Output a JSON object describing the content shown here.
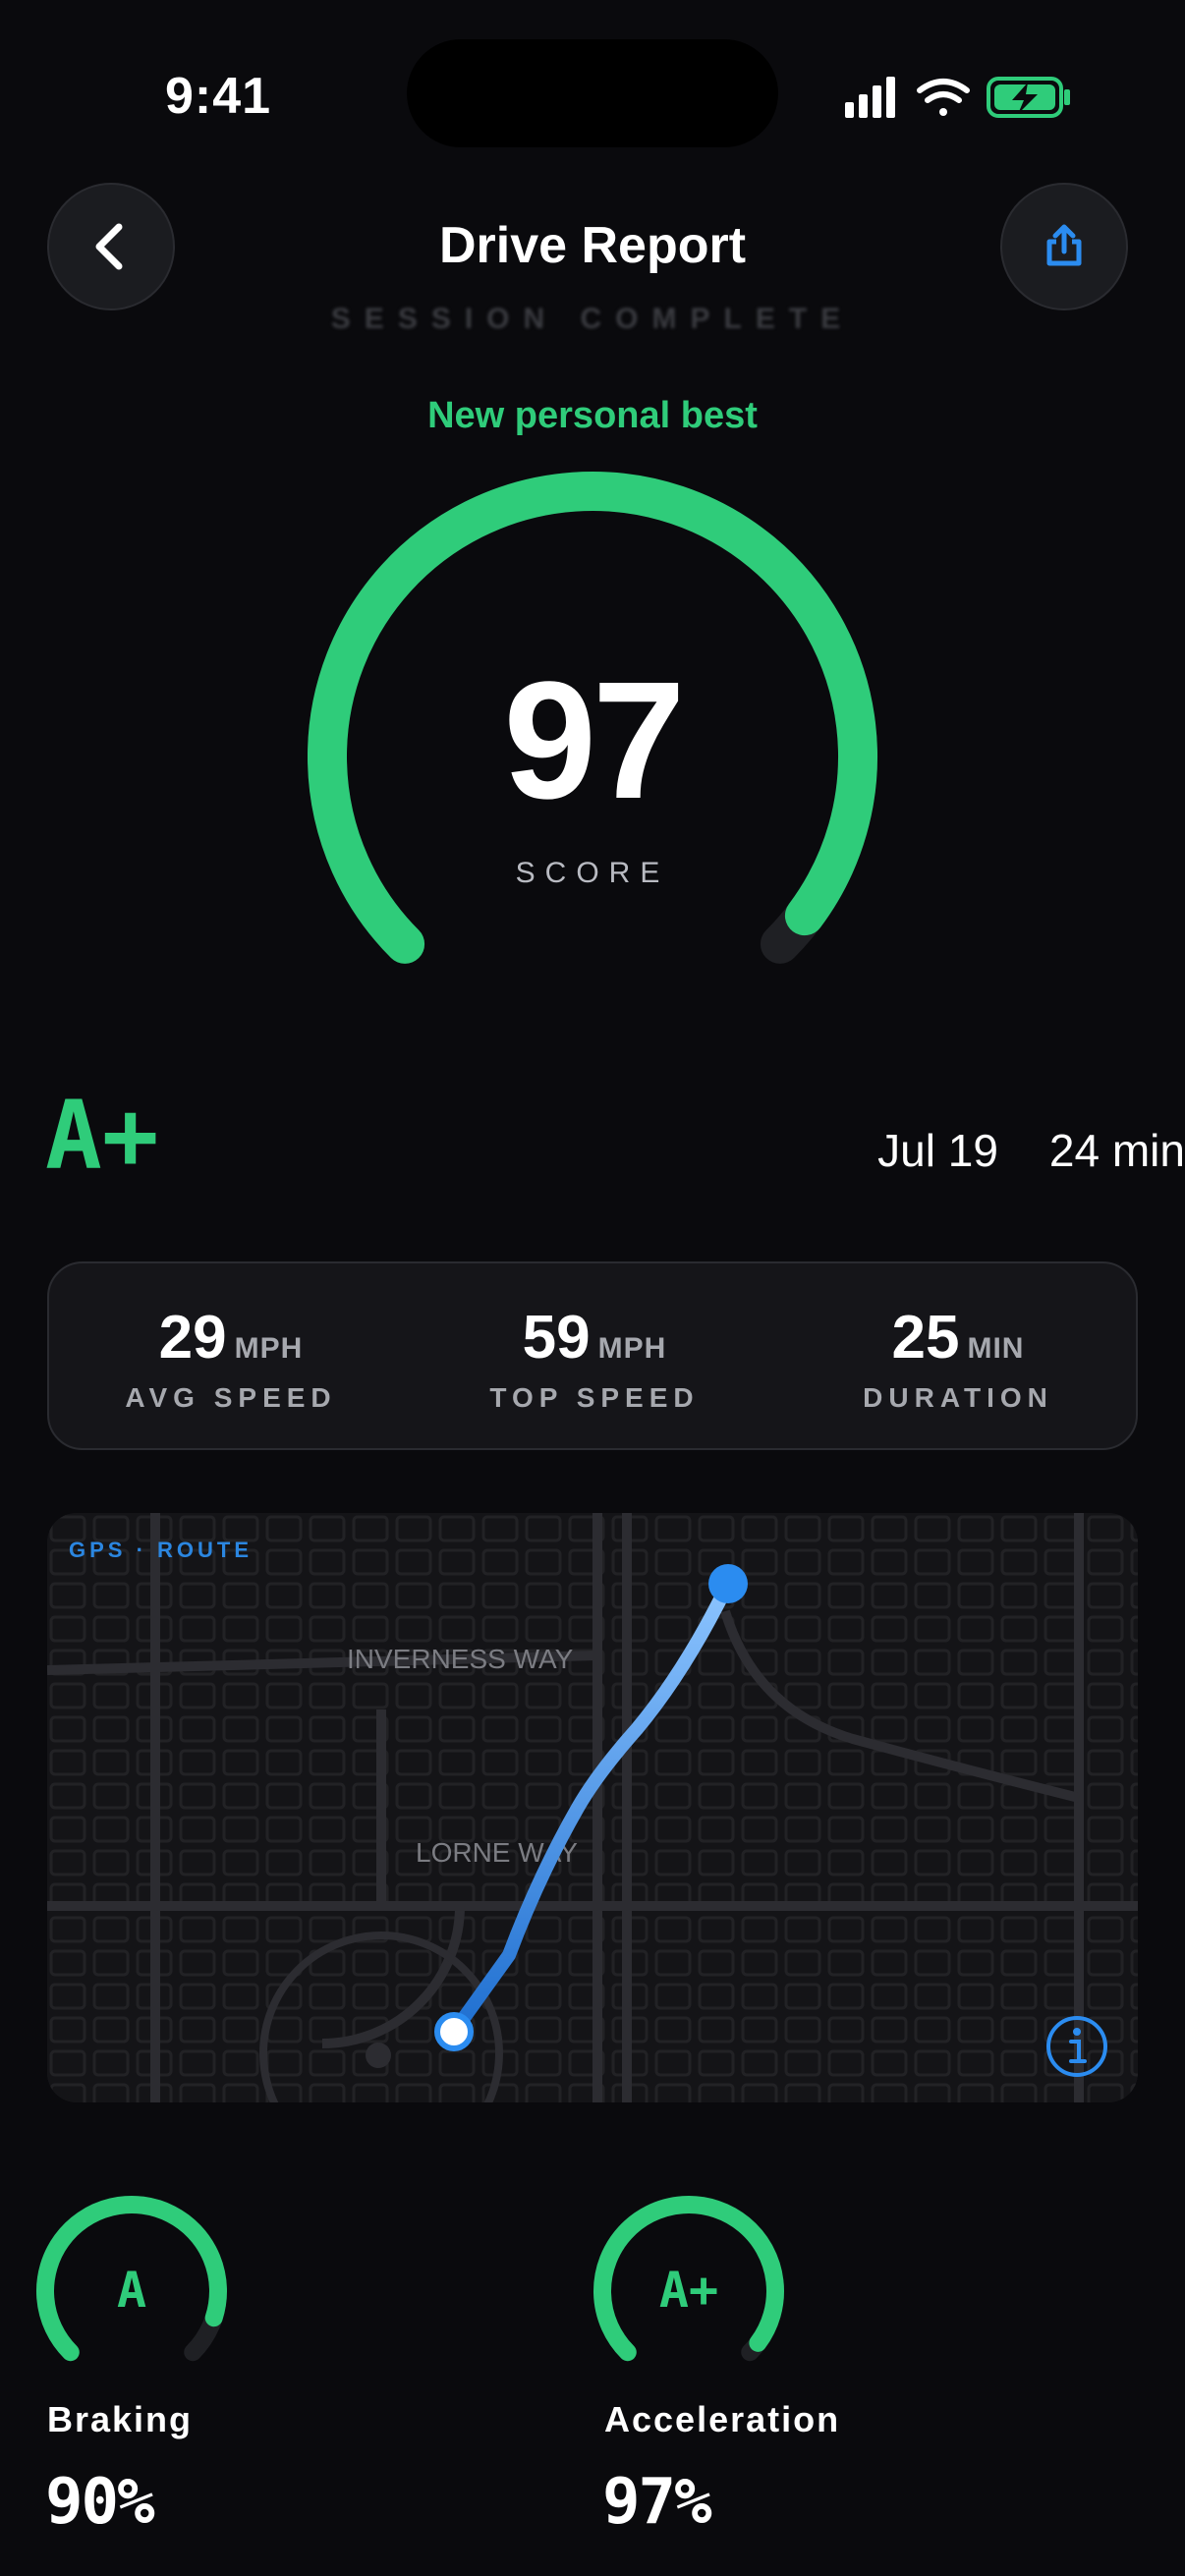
{
  "status_bar": {
    "time": "9:41"
  },
  "header": {
    "title": "Drive Report",
    "subtitle": "SESSION COMPLETE",
    "back_icon": "chevron-left-icon",
    "share_icon": "share-icon"
  },
  "score": {
    "badge": "New personal best",
    "value": "97",
    "label": "SCORE",
    "fraction": 0.97,
    "accent": "#2fcc7a"
  },
  "summary": {
    "grade": "A+",
    "date": "Jul 19",
    "duration": "24 min"
  },
  "stats": [
    {
      "value": "29",
      "unit": "MPH",
      "label": "AVG SPEED"
    },
    {
      "value": "59",
      "unit": "MPH",
      "label": "TOP SPEED"
    },
    {
      "value": "25",
      "unit": "MIN",
      "label": "DURATION"
    }
  ],
  "map": {
    "label": "GPS · ROUTE",
    "streets": [
      "INVERNESS WAY",
      "LORNE WAY"
    ],
    "route_color": "#2b8cf0",
    "info_icon": "info-icon"
  },
  "metrics": [
    {
      "name": "Braking",
      "grade": "A",
      "value": "90%",
      "fraction": 0.9
    },
    {
      "name": "Acceleration",
      "grade": "A+",
      "value": "97%",
      "fraction": 0.97
    }
  ]
}
